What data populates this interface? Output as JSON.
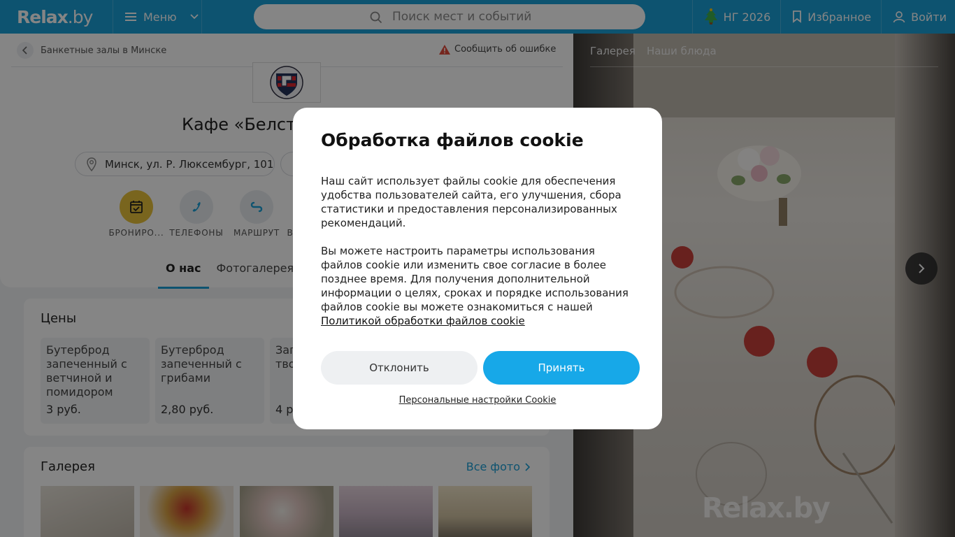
{
  "header": {
    "logo_main": "Relax",
    "logo_suffix": ".by",
    "menu_label": "Меню",
    "search_placeholder": "Поиск мест и событий",
    "ny_label": "НГ 2026",
    "favorites_label": "Избранное",
    "login_label": "Войти"
  },
  "breadcrumb": {
    "label": "Банкетные залы в Минске"
  },
  "report_error": "Сообщить об ошибке",
  "venue": {
    "title": "Кафе «Белст",
    "address": "Минск, ул. Р. Люксембург, 101"
  },
  "actions": [
    {
      "label": "БРОНИРО..."
    },
    {
      "label": "ТЕЛЕФОНЫ"
    },
    {
      "label": "МАРШРУТ"
    },
    {
      "label": "В"
    }
  ],
  "tabs": [
    {
      "label": "О нас"
    },
    {
      "label": "Фотогалерея"
    }
  ],
  "prices": {
    "title": "Цены",
    "items": [
      {
        "name": "Бутерброд запеченный с ветчиной и помидором",
        "price": "3 руб."
      },
      {
        "name": "Бутерброд запеченный с грибами",
        "price": "2,80 руб."
      },
      {
        "name": "Зап\nтво",
        "price": "4 р"
      }
    ]
  },
  "gallery": {
    "title": "Галерея",
    "all_photos": "Все фото"
  },
  "right_panel": {
    "tabs": [
      "Галерея",
      "Наши блюда"
    ],
    "watermark": "Relax.by"
  },
  "cookie": {
    "title": "Обработка файлов cookie",
    "p1": "Наш сайт использует файлы cookie для обеспечения удобства пользователей сайта, его улучшения, сбора статистики и предоставления персонализированных рекомендаций.",
    "p2": "Вы можете настроить параметры использования файлов cookie или изменить свое согласие в более позднее время. Для получения дополнительной информации о целях, сроках и порядке использования файлов cookie вы можете ознакомиться с нашей",
    "policy_link": "Политикой обработки файлов cookie",
    "decline": "Отклонить",
    "accept": "Принять",
    "personal_settings": "Персональные настройки Cookie"
  },
  "colors": {
    "brand": "#1a9fd6",
    "accept": "#17a8e8",
    "booking_icon_bg": "#e8c13a"
  }
}
